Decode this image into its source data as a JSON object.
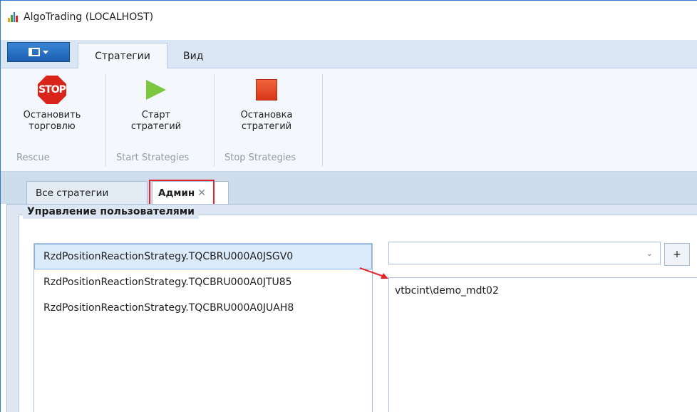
{
  "window": {
    "title": "AlgoTrading (LOCALHOST)"
  },
  "ribbon": {
    "tabs": [
      {
        "label": "Стратегии",
        "active": true
      },
      {
        "label": "Вид",
        "active": false
      }
    ],
    "groups": [
      {
        "name": "Rescue",
        "button": {
          "label_line1": "Остановить",
          "label_line2": "торговлю",
          "icon": "stop-sign-icon",
          "icon_text": "STOP"
        }
      },
      {
        "name": "Start Strategies",
        "button": {
          "label_line1": "Старт",
          "label_line2": "стратегий",
          "icon": "play-icon"
        }
      },
      {
        "name": "Stop Strategies",
        "button": {
          "label_line1": "Остановка",
          "label_line2": "стратегий",
          "icon": "stop-square-icon"
        }
      }
    ]
  },
  "doc_tabs": [
    {
      "label": "Все стратегии",
      "active": false
    },
    {
      "label": "Админ",
      "active": true,
      "close": "✕"
    }
  ],
  "admin": {
    "section_title": "Управление пользователями",
    "strategies": [
      {
        "label": "RzdPositionReactionStrategy.TQCBRU000A0JSGV0",
        "selected": true
      },
      {
        "label": "RzdPositionReactionStrategy.TQCBRU000A0JTU85",
        "selected": false
      },
      {
        "label": "RzdPositionReactionStrategy.TQCBRU000A0JUAH8",
        "selected": false
      }
    ],
    "user_combo": {
      "value": ""
    },
    "add_button": "+",
    "users": [
      "vtbcint\\demo_mdt02"
    ]
  },
  "colors": {
    "accent": "#2b7cd3",
    "highlight": "#e2242b",
    "stop": "#d9241c",
    "play": "#7cc73e"
  }
}
